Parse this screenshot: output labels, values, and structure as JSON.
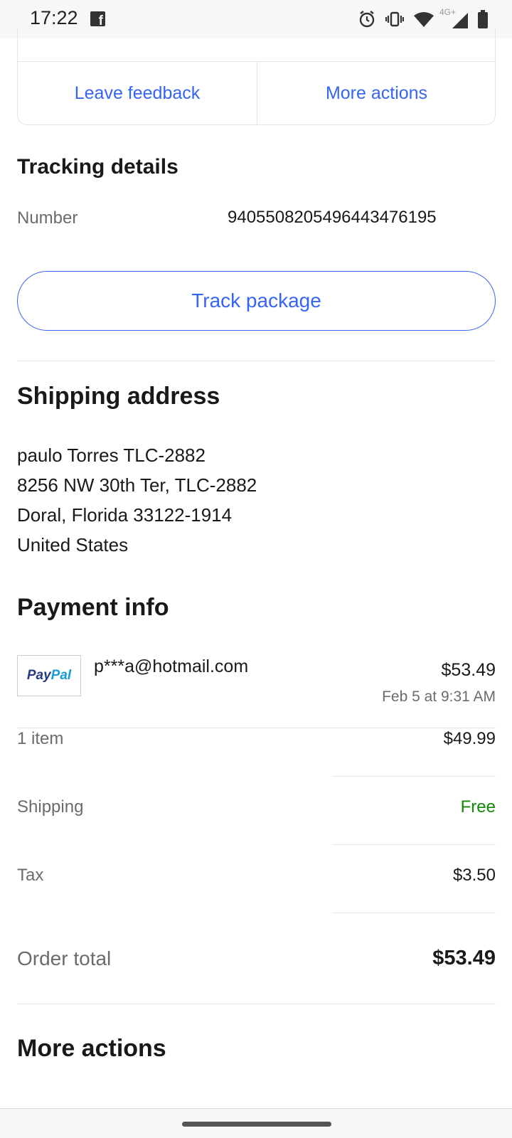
{
  "status_bar": {
    "time": "17:22",
    "network_label": "4G+",
    "icons": [
      "facebook-icon",
      "alarm-icon",
      "vibrate-icon",
      "wifi-icon",
      "signal-icon",
      "battery-icon"
    ]
  },
  "actions_card": {
    "leave_feedback": "Leave feedback",
    "more_actions": "More actions"
  },
  "tracking": {
    "title": "Tracking details",
    "number_label": "Number",
    "number_value": "9405508205496443476195",
    "track_button": "Track package"
  },
  "shipping_address": {
    "title": "Shipping address",
    "lines": [
      "paulo Torres TLC-2882",
      "8256 NW 30th Ter, TLC-2882",
      "Doral, Florida 33122-1914",
      "United States"
    ]
  },
  "payment": {
    "title": "Payment info",
    "logo_text_1": "Pay",
    "logo_text_2": "Pal",
    "email": "p***a@hotmail.com",
    "amount": "$53.49",
    "date": "Feb 5 at 9:31 AM"
  },
  "summary": {
    "items_label": "1 item",
    "items_value": "$49.99",
    "shipping_label": "Shipping",
    "shipping_value": "Free",
    "tax_label": "Tax",
    "tax_value": "$3.50",
    "total_label": "Order total",
    "total_value": "$53.49"
  },
  "more_actions": {
    "title": "More actions"
  },
  "colors": {
    "link_blue": "#3665f3",
    "free_green": "#118a00",
    "text_dark": "#191919",
    "text_gray": "#6b6b6b",
    "divider": "#e5e5e5"
  }
}
